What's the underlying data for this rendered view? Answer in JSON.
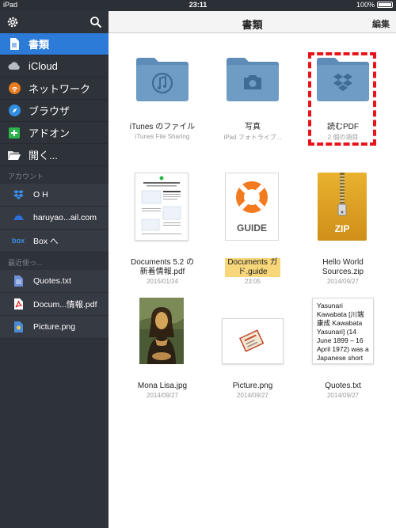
{
  "status_bar": {
    "device": "iPad",
    "time": "23:11",
    "battery": "100%"
  },
  "sidebar": {
    "nav": [
      {
        "label": "書類",
        "icon": "document-icon"
      },
      {
        "label": "iCloud",
        "icon": "cloud-icon"
      },
      {
        "label": "ネットワーク",
        "icon": "wifi-icon"
      },
      {
        "label": "ブラウザ",
        "icon": "compass-icon"
      },
      {
        "label": "アドオン",
        "icon": "plus-icon"
      },
      {
        "label": "開く...",
        "icon": "folder-open-icon"
      }
    ],
    "accounts_header": "アカウント",
    "accounts": [
      {
        "label": "O H",
        "icon": "dropbox-icon"
      },
      {
        "label": "haruyao...ail.com",
        "icon": "drive-icon"
      },
      {
        "label": "Box へ",
        "icon": "box-icon"
      }
    ],
    "recent_header": "最近使っ...",
    "recent": [
      {
        "label": "Quotes.txt",
        "icon": "txt-file-icon"
      },
      {
        "label": "Docum...情報.pdf",
        "icon": "pdf-file-icon"
      },
      {
        "label": "Picture.png",
        "icon": "image-file-icon"
      }
    ]
  },
  "main": {
    "title": "書類",
    "edit_label": "編集",
    "items": [
      {
        "name": "iTunes のファイル",
        "sub": "iTunes File Sharing"
      },
      {
        "name": "写真",
        "sub": "iPad フォトライブ..."
      },
      {
        "name": "読むPDF",
        "sub": "2 個の項目"
      },
      {
        "name_line1": "Documents 5.2 の",
        "name_line2": "新着情報.pdf",
        "sub": "2015/01/24"
      },
      {
        "name_line1": "Documents ガイ",
        "name_line2": "ド.guide",
        "sub": "23:05",
        "thumb_label": "GUIDE"
      },
      {
        "name_line1": "Hello World",
        "name_line2": "Sources.zip",
        "sub": "2014/09/27",
        "thumb_label": "ZIP"
      },
      {
        "name": "Mona Lisa.jpg",
        "sub": "2014/09/27"
      },
      {
        "name": "Picture.png",
        "sub": "2014/09/27"
      },
      {
        "name": "Quotes.txt",
        "sub": "2014/09/27",
        "preview_text": "Yasunari Kawabata [川端 康成 Kawabata Yasunari] (14 June 1899 – 16 April 1972) was a Japanese short"
      }
    ]
  },
  "colors": {
    "accent": "#2d7bd8",
    "folder": "#6e9cc4",
    "selection": "#e8141b",
    "sidebar_bg": "#2e3239"
  }
}
